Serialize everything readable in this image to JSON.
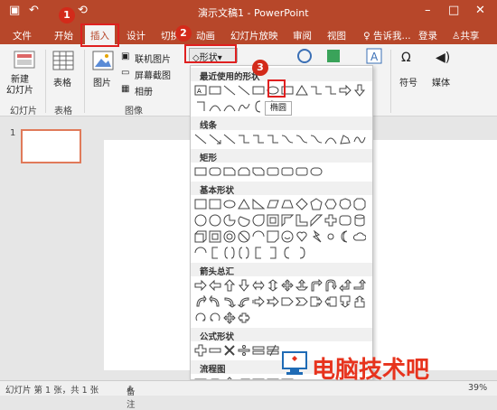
{
  "titlebar": {
    "title": "演示文稿1 - PowerPoint",
    "icons": [
      "save-icon",
      "undo-icon",
      "quick-access-icon",
      "minimize-icon",
      "maximize-icon",
      "close-icon"
    ]
  },
  "menubar": {
    "tabs": [
      "文件",
      "开始",
      "插入",
      "设计",
      "切换",
      "动画",
      "幻灯片放映",
      "审阅",
      "视图"
    ],
    "tell_me": "♀ 告诉我...",
    "login": "登录",
    "share": "共享"
  },
  "ribbon": {
    "new_slide": "新建\n幻灯片",
    "table": "表格",
    "picture": "图片",
    "online_picture": "联机图片",
    "screenshot": "屏幕截图",
    "album": "相册",
    "shapes_button": "形状",
    "symbol": "符号",
    "media": "媒体",
    "groups": {
      "slides": "幻灯片",
      "tables": "表格",
      "images": "图像"
    }
  },
  "dropdown": {
    "sections": [
      "最近使用的形状",
      "线条",
      "矩形",
      "基本形状",
      "箭头总汇",
      "公式形状",
      "流程图"
    ],
    "tooltip": "椭圆"
  },
  "callouts": [
    "1",
    "2",
    "3"
  ],
  "slide_pane": {
    "thumb_number": "1"
  },
  "status": {
    "slide_info": "幻灯片 第 1 张，共 1 张",
    "notes": "备注",
    "zoom": "39%"
  },
  "watermark": {
    "text": "电脑技术吧"
  },
  "colors": {
    "accent": "#b7472a",
    "callout": "#d32a1a",
    "highlight": "#e02020",
    "watermark_text": "#e7331d",
    "watermark_icon": "#1f6bb5"
  }
}
